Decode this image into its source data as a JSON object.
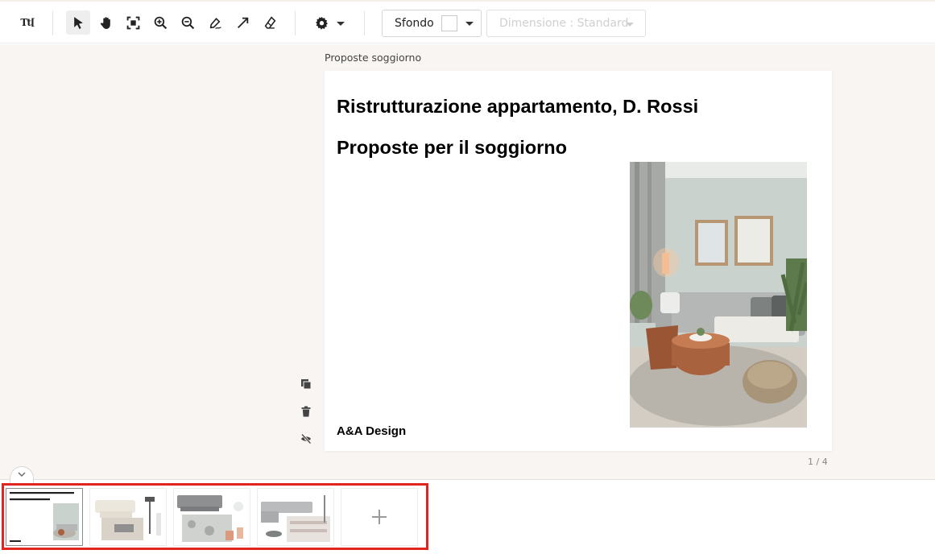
{
  "toolbar": {
    "text_tool_label": "Tt[",
    "tools": [
      "text-tool",
      "select-arrow-icon",
      "hand-icon",
      "fit-screen-icon",
      "zoom-in-icon",
      "zoom-out-icon",
      "pen-icon",
      "arrow-icon",
      "eraser-icon",
      "gear-icon"
    ],
    "background_label": "Sfondo",
    "background_color": "#ffffff",
    "size_label": "Dimensione : Standard"
  },
  "slide": {
    "caption": "Proposte soggiorno",
    "title": "Ristrutturazione appartamento, D. Rossi",
    "subtitle": "Proposte per il soggiorno",
    "footer": "A&A Design",
    "page_counter": "1 / 4"
  },
  "side_tools": [
    "duplicate-icon",
    "trash-icon",
    "hide-icon"
  ],
  "thumbnails": {
    "count": 4,
    "selected_index": 0,
    "add_icon": "plus-icon"
  },
  "colors": {
    "canvas_bg": "#f8f5f2",
    "highlight": "#e0241f"
  }
}
